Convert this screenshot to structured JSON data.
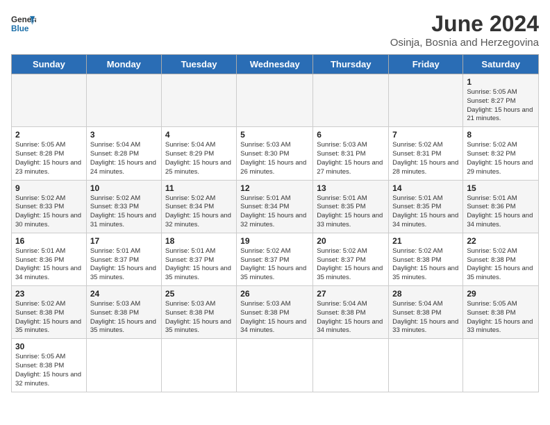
{
  "header": {
    "logo_general": "General",
    "logo_blue": "Blue",
    "title": "June 2024",
    "subtitle": "Osinja, Bosnia and Herzegovina"
  },
  "days_of_week": [
    "Sunday",
    "Monday",
    "Tuesday",
    "Wednesday",
    "Thursday",
    "Friday",
    "Saturday"
  ],
  "weeks": [
    [
      {
        "day": "",
        "info": ""
      },
      {
        "day": "",
        "info": ""
      },
      {
        "day": "",
        "info": ""
      },
      {
        "day": "",
        "info": ""
      },
      {
        "day": "",
        "info": ""
      },
      {
        "day": "",
        "info": ""
      },
      {
        "day": "1",
        "info": "Sunrise: 5:05 AM\nSunset: 8:27 PM\nDaylight: 15 hours and 21 minutes."
      }
    ],
    [
      {
        "day": "2",
        "info": "Sunrise: 5:05 AM\nSunset: 8:28 PM\nDaylight: 15 hours and 23 minutes."
      },
      {
        "day": "3",
        "info": "Sunrise: 5:04 AM\nSunset: 8:28 PM\nDaylight: 15 hours and 24 minutes."
      },
      {
        "day": "4",
        "info": "Sunrise: 5:04 AM\nSunset: 8:29 PM\nDaylight: 15 hours and 25 minutes."
      },
      {
        "day": "5",
        "info": "Sunrise: 5:03 AM\nSunset: 8:30 PM\nDaylight: 15 hours and 26 minutes."
      },
      {
        "day": "6",
        "info": "Sunrise: 5:03 AM\nSunset: 8:31 PM\nDaylight: 15 hours and 27 minutes."
      },
      {
        "day": "7",
        "info": "Sunrise: 5:02 AM\nSunset: 8:31 PM\nDaylight: 15 hours and 28 minutes."
      },
      {
        "day": "8",
        "info": "Sunrise: 5:02 AM\nSunset: 8:32 PM\nDaylight: 15 hours and 29 minutes."
      }
    ],
    [
      {
        "day": "9",
        "info": "Sunrise: 5:02 AM\nSunset: 8:33 PM\nDaylight: 15 hours and 30 minutes."
      },
      {
        "day": "10",
        "info": "Sunrise: 5:02 AM\nSunset: 8:33 PM\nDaylight: 15 hours and 31 minutes."
      },
      {
        "day": "11",
        "info": "Sunrise: 5:02 AM\nSunset: 8:34 PM\nDaylight: 15 hours and 32 minutes."
      },
      {
        "day": "12",
        "info": "Sunrise: 5:01 AM\nSunset: 8:34 PM\nDaylight: 15 hours and 32 minutes."
      },
      {
        "day": "13",
        "info": "Sunrise: 5:01 AM\nSunset: 8:35 PM\nDaylight: 15 hours and 33 minutes."
      },
      {
        "day": "14",
        "info": "Sunrise: 5:01 AM\nSunset: 8:35 PM\nDaylight: 15 hours and 34 minutes."
      },
      {
        "day": "15",
        "info": "Sunrise: 5:01 AM\nSunset: 8:36 PM\nDaylight: 15 hours and 34 minutes."
      }
    ],
    [
      {
        "day": "16",
        "info": "Sunrise: 5:01 AM\nSunset: 8:36 PM\nDaylight: 15 hours and 34 minutes."
      },
      {
        "day": "17",
        "info": "Sunrise: 5:01 AM\nSunset: 8:37 PM\nDaylight: 15 hours and 35 minutes."
      },
      {
        "day": "18",
        "info": "Sunrise: 5:01 AM\nSunset: 8:37 PM\nDaylight: 15 hours and 35 minutes."
      },
      {
        "day": "19",
        "info": "Sunrise: 5:02 AM\nSunset: 8:37 PM\nDaylight: 15 hours and 35 minutes."
      },
      {
        "day": "20",
        "info": "Sunrise: 5:02 AM\nSunset: 8:37 PM\nDaylight: 15 hours and 35 minutes."
      },
      {
        "day": "21",
        "info": "Sunrise: 5:02 AM\nSunset: 8:38 PM\nDaylight: 15 hours and 35 minutes."
      },
      {
        "day": "22",
        "info": "Sunrise: 5:02 AM\nSunset: 8:38 PM\nDaylight: 15 hours and 35 minutes."
      }
    ],
    [
      {
        "day": "23",
        "info": "Sunrise: 5:02 AM\nSunset: 8:38 PM\nDaylight: 15 hours and 35 minutes."
      },
      {
        "day": "24",
        "info": "Sunrise: 5:03 AM\nSunset: 8:38 PM\nDaylight: 15 hours and 35 minutes."
      },
      {
        "day": "25",
        "info": "Sunrise: 5:03 AM\nSunset: 8:38 PM\nDaylight: 15 hours and 35 minutes."
      },
      {
        "day": "26",
        "info": "Sunrise: 5:03 AM\nSunset: 8:38 PM\nDaylight: 15 hours and 34 minutes."
      },
      {
        "day": "27",
        "info": "Sunrise: 5:04 AM\nSunset: 8:38 PM\nDaylight: 15 hours and 34 minutes."
      },
      {
        "day": "28",
        "info": "Sunrise: 5:04 AM\nSunset: 8:38 PM\nDaylight: 15 hours and 33 minutes."
      },
      {
        "day": "29",
        "info": "Sunrise: 5:05 AM\nSunset: 8:38 PM\nDaylight: 15 hours and 33 minutes."
      }
    ],
    [
      {
        "day": "30",
        "info": "Sunrise: 5:05 AM\nSunset: 8:38 PM\nDaylight: 15 hours and 32 minutes."
      },
      {
        "day": "",
        "info": ""
      },
      {
        "day": "",
        "info": ""
      },
      {
        "day": "",
        "info": ""
      },
      {
        "day": "",
        "info": ""
      },
      {
        "day": "",
        "info": ""
      },
      {
        "day": "",
        "info": ""
      }
    ]
  ],
  "accent_color": "#2a6db5"
}
